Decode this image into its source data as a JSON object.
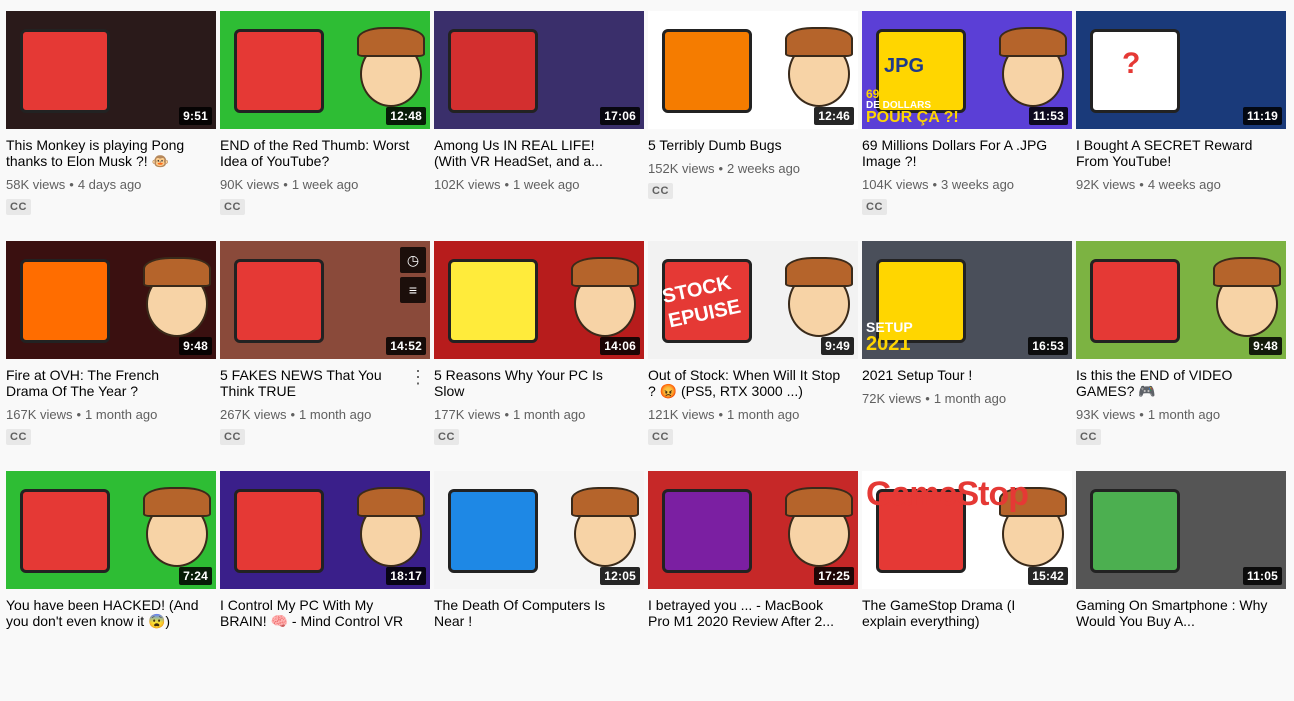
{
  "videos": [
    {
      "title": "This Monkey is playing Pong thanks to Elon Musk ?! 🐵",
      "views": "58K views",
      "age": "4 days ago",
      "duration": "9:51",
      "cc": "CC",
      "bg": "#2a1a1a",
      "accent": "#e53935"
    },
    {
      "title": "END of the Red Thumb: Worst Idea of YouTube?",
      "views": "90K views",
      "age": "1 week ago",
      "duration": "12:48",
      "cc": "CC",
      "bg": "#2ebd34",
      "accent": "#e53935"
    },
    {
      "title": "Among Us IN REAL LIFE! (With VR HeadSet, and a...",
      "views": "102K views",
      "age": "1 week ago",
      "duration": "17:06",
      "cc": "",
      "bg": "#3a2f6b",
      "accent": "#d32f2f"
    },
    {
      "title": "5 Terribly Dumb Bugs",
      "views": "152K views",
      "age": "2 weeks ago",
      "duration": "12:46",
      "cc": "CC",
      "bg": "#ffffff",
      "accent": "#f57c00"
    },
    {
      "title": "69 Millions Dollars For A .JPG Image ?!",
      "views": "104K views",
      "age": "3 weeks ago",
      "duration": "11:53",
      "cc": "CC",
      "bg": "#5b3fd6",
      "accent": "#ffd600"
    },
    {
      "title": "I Bought A SECRET Reward From YouTube!",
      "views": "92K views",
      "age": "4 weeks ago",
      "duration": "11:19",
      "cc": "",
      "bg": "#1a3a7a",
      "accent": "#ffffff"
    },
    {
      "title": "Fire at OVH: The French Drama Of The Year ?",
      "views": "167K views",
      "age": "1 month ago",
      "duration": "9:48",
      "cc": "CC",
      "bg": "#3a1010",
      "accent": "#ff6d00"
    },
    {
      "title": "5 FAKES NEWS That You Think TRUE",
      "views": "267K views",
      "age": "1 month ago",
      "duration": "14:52",
      "cc": "CC",
      "bg": "#8a4a3a",
      "accent": "#e53935"
    },
    {
      "title": "5 Reasons Why Your PC Is Slow",
      "views": "177K views",
      "age": "1 month ago",
      "duration": "14:06",
      "cc": "CC",
      "bg": "#b71c1c",
      "accent": "#ffeb3b"
    },
    {
      "title": "Out of Stock: When Will It Stop ? 😡 (PS5, RTX 3000 ...)",
      "views": "121K views",
      "age": "1 month ago",
      "duration": "9:49",
      "cc": "CC",
      "bg": "#f2f2f2",
      "accent": "#e53935"
    },
    {
      "title": "2021 Setup Tour !",
      "views": "72K views",
      "age": "1 month ago",
      "duration": "16:53",
      "cc": "",
      "bg": "#4a4f5a",
      "accent": "#ffd600"
    },
    {
      "title": "Is this the END of VIDEO GAMES? 🎮",
      "views": "93K views",
      "age": "1 month ago",
      "duration": "9:48",
      "cc": "CC",
      "bg": "#7cb342",
      "accent": "#e53935"
    },
    {
      "title": "You have been HACKED! (And you don't even know it 😨)",
      "views": "",
      "age": "",
      "duration": "7:24",
      "cc": "",
      "bg": "#2ebd34",
      "accent": "#e53935"
    },
    {
      "title": "I Control My PC With My BRAIN! 🧠 - Mind Control VR",
      "views": "",
      "age": "",
      "duration": "18:17",
      "cc": "",
      "bg": "#3a1f8a",
      "accent": "#e53935"
    },
    {
      "title": "The Death Of Computers Is Near !",
      "views": "",
      "age": "",
      "duration": "12:05",
      "cc": "",
      "bg": "#f5f5f5",
      "accent": "#1e88e5"
    },
    {
      "title": "I betrayed you ... - MacBook Pro M1 2020 Review After 2...",
      "views": "",
      "age": "",
      "duration": "17:25",
      "cc": "",
      "bg": "#c62828",
      "accent": "#7b1fa2"
    },
    {
      "title": "The GameStop Drama (I explain everything)",
      "views": "",
      "age": "",
      "duration": "15:42",
      "cc": "",
      "bg": "#ffffff",
      "accent": "#e53935"
    },
    {
      "title": "Gaming On Smartphone : Why Would You Buy A...",
      "views": "",
      "age": "",
      "duration": "11:05",
      "cc": "",
      "bg": "#555555",
      "accent": "#4caf50"
    }
  ],
  "overlay_texts": {
    "jpg": "JPG",
    "millions": "69 MILLIONS",
    "dollars": "DE DOLLARS",
    "pourca": "POUR ÇA ?!",
    "stock": "STOCK",
    "epuise": "EPUISE",
    "setup": "SETUP",
    "year": "2021",
    "gamestop": "GameStop",
    "question": "?"
  },
  "hover_icons": [
    "clock-icon",
    "queue-icon"
  ]
}
